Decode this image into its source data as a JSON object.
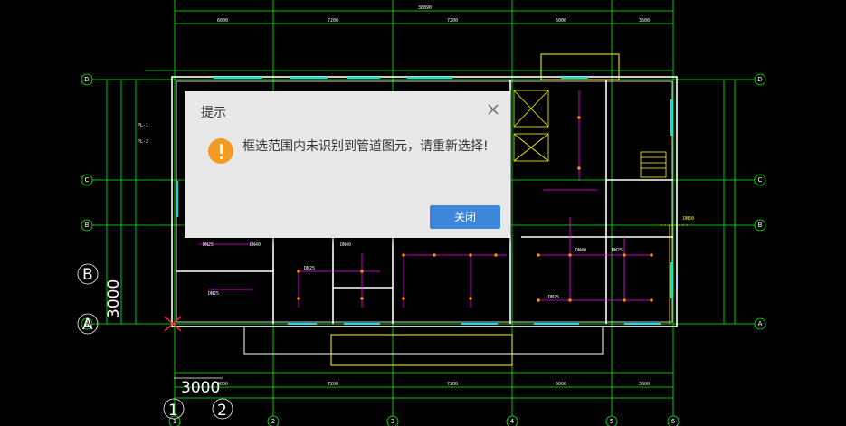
{
  "dialog": {
    "title": "提示",
    "message": "框选范围内未识别到管道图元，请重新选择!",
    "close_button": "关闭"
  },
  "drawing": {
    "axis_rows": [
      "D",
      "C",
      "B",
      "A"
    ],
    "axis_cols": [
      "1",
      "2",
      "3",
      "4",
      "5",
      "6"
    ],
    "overlay_labels": [
      "B",
      "A",
      "3000",
      "3000",
      "1",
      "2"
    ],
    "top_dims": [
      "38890",
      "6000",
      "7200",
      "7200",
      "6000",
      "7200",
      "3600"
    ],
    "bottom_dims": [
      "6000",
      "7200",
      "7200",
      "6000",
      "3600"
    ],
    "room_labels": [
      "DN25",
      "DN40",
      "DN25",
      "DN40",
      "DN25",
      "DN25",
      "DN40",
      "DN25",
      "PL-1",
      "PL-2",
      "DN50"
    ]
  },
  "colors": {
    "background": "#000000",
    "grid_green": "#00ff00",
    "wall": "#ffffff",
    "window_cyan": "#00e5e5",
    "pipe_magenta": "#ff00ff",
    "pipe_yellow": "#ffff00",
    "dialog_bg": "#e8e8e8",
    "button_blue": "#3d86dc",
    "warning_orange": "#f59a23"
  }
}
